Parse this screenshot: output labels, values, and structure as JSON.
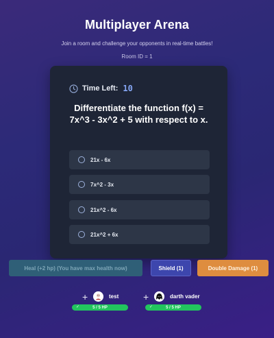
{
  "header": {
    "title": "Multiplayer Arena",
    "subtitle": "Join a room and challenge your opponents in real-time battles!",
    "room_id": "Room ID = 1"
  },
  "quiz": {
    "timer_label": "Time Left:",
    "timer_value": "10",
    "question": "Differentiate the function f(x) = 7x^3 - 3x^2 + 5 with respect to x.",
    "options": [
      {
        "label": "21x - 6x"
      },
      {
        "label": "7x^2 - 3x"
      },
      {
        "label": "21x^2 - 6x"
      },
      {
        "label": "21x^2 + 6x"
      }
    ]
  },
  "abilities": {
    "heal_label": "Heal (+2 hp) (You have max health now)",
    "shield_label": "Shield (1)",
    "double_damage_label": "Double Damage (1)"
  },
  "players": [
    {
      "name": "test",
      "hp_text": "5 / 5 HP",
      "hp_fraction": 1.0,
      "avatar_icon": "avatar-icon"
    },
    {
      "name": "darth vader",
      "hp_text": "5 / 5 HP",
      "hp_fraction": 1.0,
      "avatar_icon": "darth-vader-avatar-icon"
    }
  ],
  "colors": {
    "background": "#2c2a78",
    "card": "#1e2536",
    "option": "#2d3647",
    "timer_value": "#86a7f5",
    "heal_button": "#2f5f77",
    "shield_button": "#3d46ad",
    "double_damage_button": "#de8d3f",
    "hp_bar": "#22c55e"
  }
}
